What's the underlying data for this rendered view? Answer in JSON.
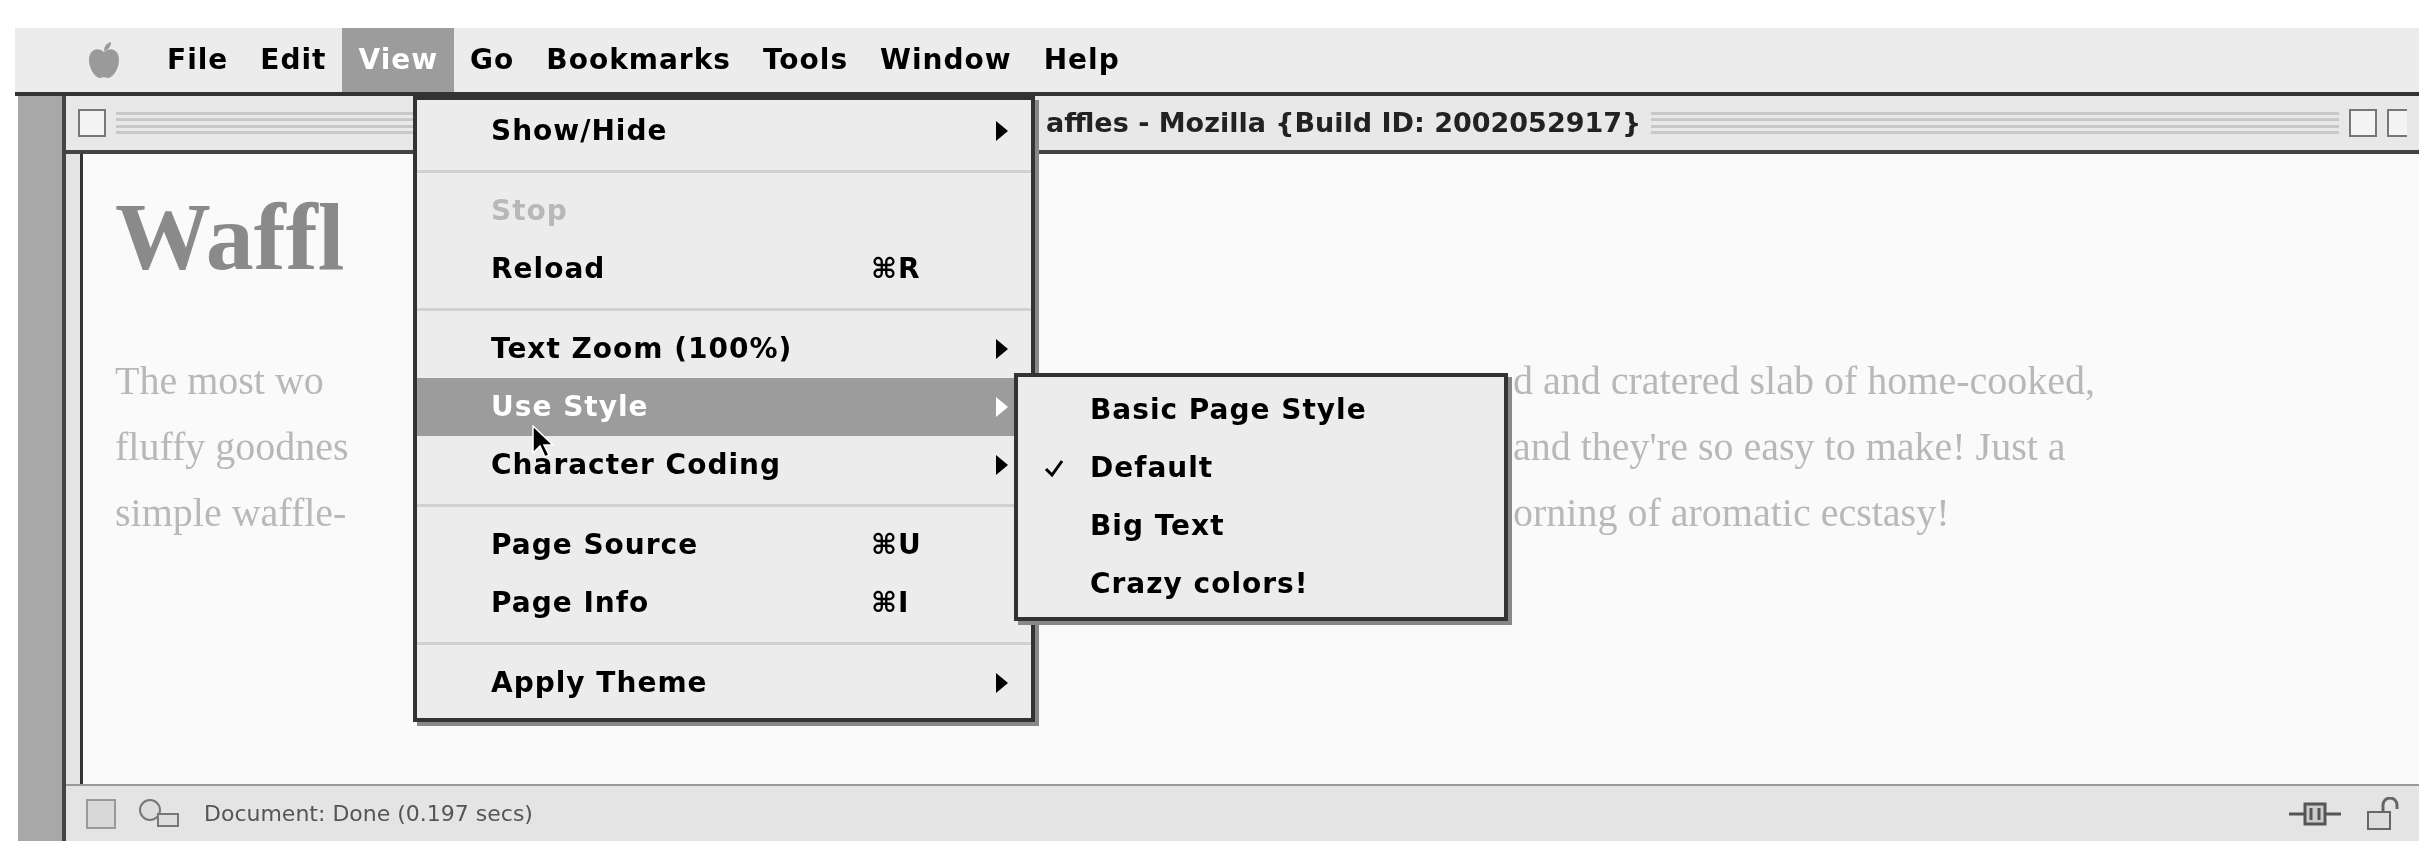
{
  "menu_bar": {
    "items": [
      {
        "label": "File",
        "selected": false
      },
      {
        "label": "Edit",
        "selected": false
      },
      {
        "label": "View",
        "selected": true
      },
      {
        "label": "Go",
        "selected": false
      },
      {
        "label": "Bookmarks",
        "selected": false
      },
      {
        "label": "Tools",
        "selected": false
      },
      {
        "label": "Window",
        "selected": false
      },
      {
        "label": "Help",
        "selected": false
      }
    ]
  },
  "window": {
    "title": "affles - Mozilla {Build ID: 2002052917}"
  },
  "page": {
    "heading": "Waffl",
    "lines": [
      {
        "left": "The most wo",
        "right": "d and cratered slab of home-cooked,"
      },
      {
        "left": "fluffy goodnes",
        "right": "and they're so easy to make! Just a"
      },
      {
        "left": "simple waffle-",
        "right": "orning of aromatic ecstasy!"
      }
    ]
  },
  "view_menu": {
    "items": [
      {
        "kind": "item",
        "label": "Show/Hide",
        "submenu": true,
        "disabled": false,
        "selected": false
      },
      {
        "kind": "separator"
      },
      {
        "kind": "item",
        "label": "Stop",
        "submenu": false,
        "disabled": true,
        "selected": false
      },
      {
        "kind": "item",
        "label": "Reload",
        "shortcut": "⌘R",
        "submenu": false,
        "disabled": false,
        "selected": false
      },
      {
        "kind": "separator"
      },
      {
        "kind": "item",
        "label": "Text Zoom (100%)",
        "submenu": true,
        "disabled": false,
        "selected": false
      },
      {
        "kind": "item",
        "label": "Use Style",
        "submenu": true,
        "disabled": false,
        "selected": true
      },
      {
        "kind": "item",
        "label": "Character Coding",
        "submenu": true,
        "disabled": false,
        "selected": false
      },
      {
        "kind": "separator"
      },
      {
        "kind": "item",
        "label": "Page Source",
        "shortcut": "⌘U",
        "submenu": false,
        "disabled": false,
        "selected": false
      },
      {
        "kind": "item",
        "label": "Page Info",
        "shortcut": "⌘I",
        "submenu": false,
        "disabled": false,
        "selected": false
      },
      {
        "kind": "separator"
      },
      {
        "kind": "item",
        "label": "Apply Theme",
        "submenu": true,
        "disabled": false,
        "selected": false
      }
    ]
  },
  "style_submenu": {
    "items": [
      {
        "label": "Basic Page Style",
        "checked": false
      },
      {
        "label": "Default",
        "checked": true
      },
      {
        "label": "Big Text",
        "checked": false
      },
      {
        "label": "Crazy colors!",
        "checked": false
      }
    ]
  },
  "status_bar": {
    "text": "Document: Done (0.197 secs)"
  }
}
